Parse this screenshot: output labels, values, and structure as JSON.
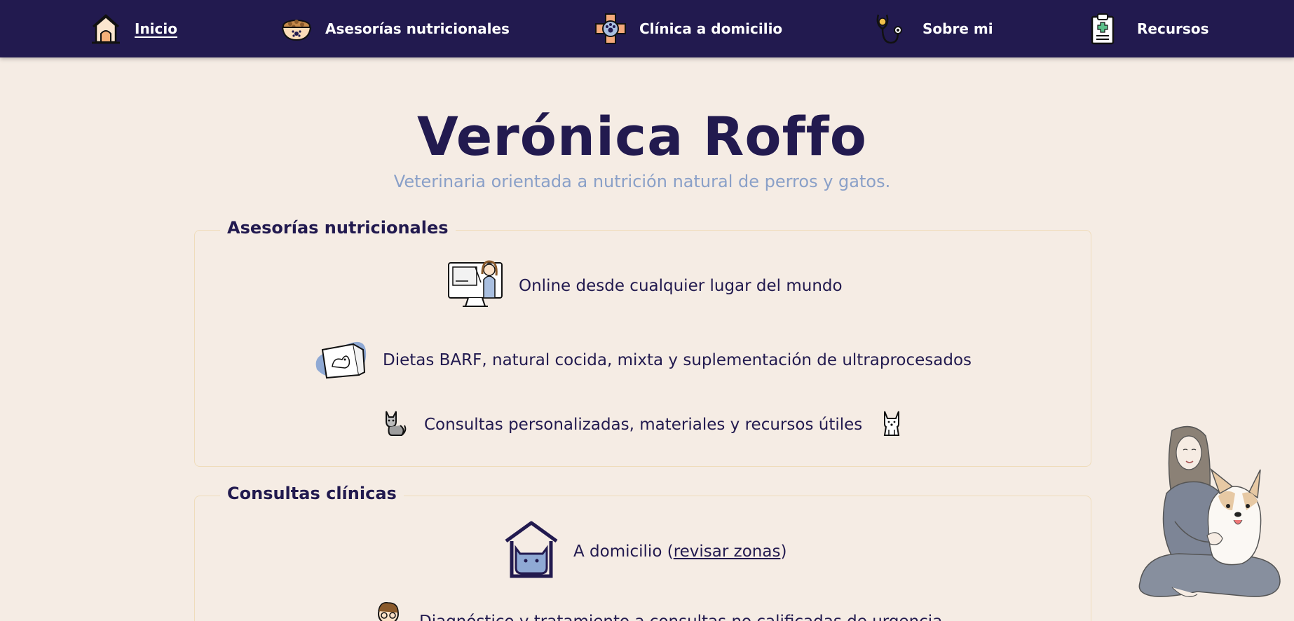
{
  "nav": {
    "items": [
      {
        "label": "Inicio",
        "icon": "doghouse-icon",
        "active": true
      },
      {
        "label": "Asesorías nutricionales",
        "icon": "food-bowl-icon",
        "active": false
      },
      {
        "label": "Clínica a domicilio",
        "icon": "medical-cross-icon",
        "active": false
      },
      {
        "label": "Sobre mi",
        "icon": "stethoscope-icon",
        "active": false
      },
      {
        "label": "Recursos",
        "icon": "clipboard-icon",
        "active": false
      }
    ]
  },
  "header": {
    "title": "Verónica Roffo",
    "subtitle": "Veterinaria orientada a nutrición natural de perros y gatos."
  },
  "sections": {
    "nutrition": {
      "title": "Asesorías nutricionales",
      "items": [
        {
          "text": "Online desde cualquier lugar del mundo",
          "icon": "computer-vet-icon"
        },
        {
          "text": "Dietas BARF, natural cocida, mixta y suplementación de ultraprocesados",
          "icon": "pet-food-bag-icon"
        },
        {
          "text": "Consultas personalizadas, materiales y recursos útiles",
          "icon": "cat-icon",
          "icon_right": "dog-icon"
        }
      ]
    },
    "clinic": {
      "title": "Consultas clínicas",
      "items": [
        {
          "text_before": "A domicilio (",
          "link": "revisar zonas",
          "text_after": ")",
          "icon": "cat-house-icon"
        },
        {
          "text": "Diagnóstico y tratamiento a consultas no calificadas de urgencia",
          "icon": "vet-avatar-icon"
        }
      ]
    }
  },
  "colors": {
    "nav_bg": "#221a4f",
    "page_bg": "#f5ece4",
    "title": "#221a4f",
    "subtitle": "#8aa0c8",
    "section_border": "#efdcbb"
  }
}
